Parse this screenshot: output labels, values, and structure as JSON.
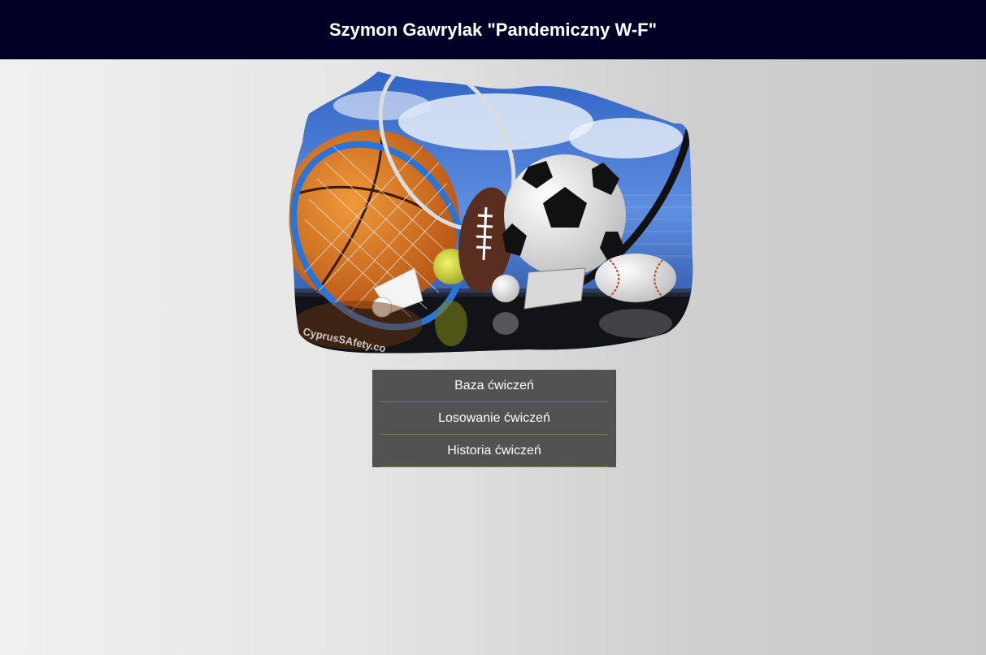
{
  "header": {
    "title": "Szymon Gawrylak \"Pandemiczny W-F\""
  },
  "hero": {
    "watermark": "CyprusSAfety.co",
    "icon": "sports-equipment-collage"
  },
  "menu": {
    "items": [
      {
        "label": "Baza ćwiczeń"
      },
      {
        "label": "Losowanie ćwiczeń"
      },
      {
        "label": "Historia ćwiczeń"
      }
    ]
  },
  "colors": {
    "header_bg": "#000026",
    "menu_bg": "#525252",
    "menu_divider": "#8b7a55"
  }
}
